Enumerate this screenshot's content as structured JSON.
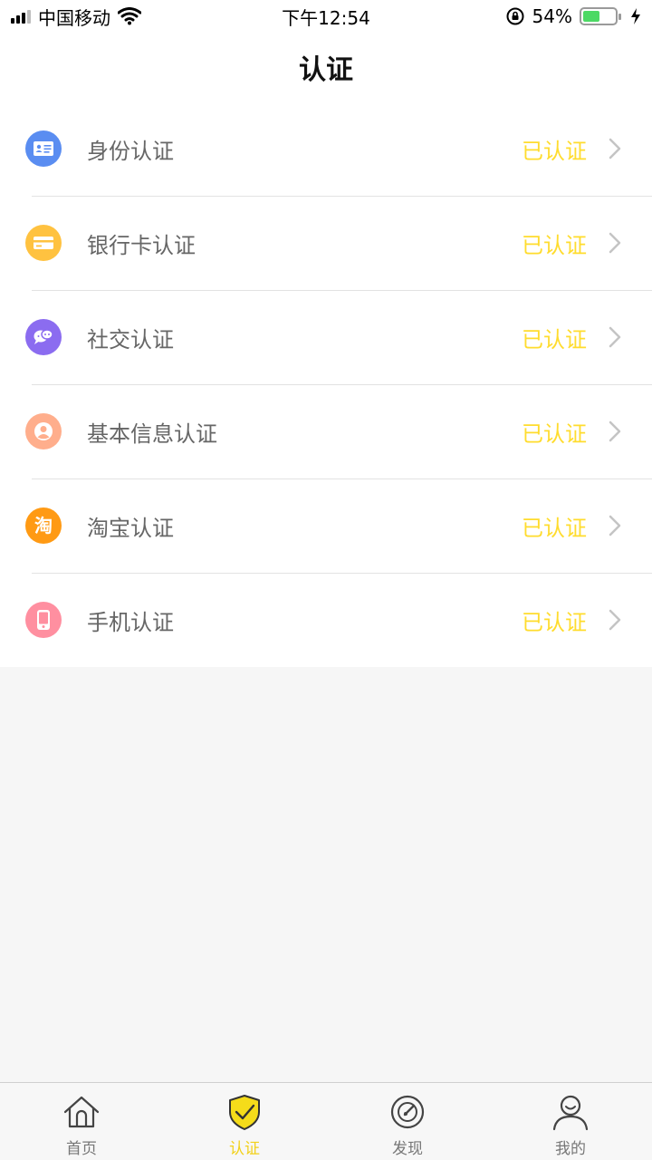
{
  "status_bar": {
    "carrier": "中国移动",
    "time": "下午12:54",
    "battery_percent": "54%",
    "battery_level": 0.54
  },
  "header": {
    "title": "认证"
  },
  "colors": {
    "accent": "#ffdc2e",
    "id_icon": "#5a8df1",
    "bank_icon": "#ffc240",
    "social_icon": "#8b6cf0",
    "basic_icon": "#ffae8c",
    "taobao_icon": "#ff9a14",
    "phone_icon": "#ff8fa0"
  },
  "list": {
    "items": [
      {
        "label": "身份认证",
        "status": "已认证",
        "icon": "id-card-icon"
      },
      {
        "label": "银行卡认证",
        "status": "已认证",
        "icon": "bank-card-icon"
      },
      {
        "label": "社交认证",
        "status": "已认证",
        "icon": "social-chat-icon"
      },
      {
        "label": "基本信息认证",
        "status": "已认证",
        "icon": "user-profile-icon"
      },
      {
        "label": "淘宝认证",
        "status": "已认证",
        "icon": "taobao-icon",
        "icon_text": "淘"
      },
      {
        "label": "手机认证",
        "status": "已认证",
        "icon": "phone-icon"
      }
    ]
  },
  "tabbar": {
    "tabs": [
      {
        "label": "首页",
        "icon": "home-icon",
        "active": false
      },
      {
        "label": "认证",
        "icon": "shield-check-icon",
        "active": true
      },
      {
        "label": "发现",
        "icon": "compass-icon",
        "active": false
      },
      {
        "label": "我的",
        "icon": "person-icon",
        "active": false
      }
    ]
  }
}
